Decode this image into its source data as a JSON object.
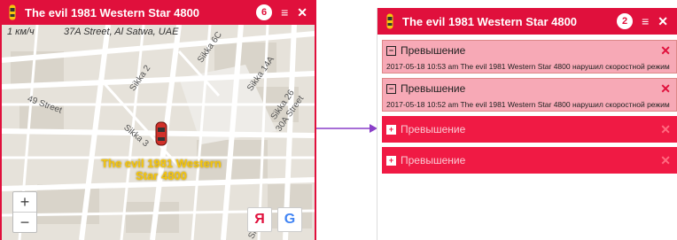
{
  "map_window": {
    "title": "The evil 1981 Western Star 4800",
    "badge": "6",
    "scale": "1 км/ч",
    "address": "37A Street, Al Satwa, UAE",
    "streets": [
      "Sikka 6C",
      "Sikka 2",
      "Sikka 14A",
      "49 Street",
      "Sikka 26",
      "Sikka 3",
      "30A Street",
      "Sikka"
    ],
    "vehicle_label_line1": "The evil 1981 Western",
    "vehicle_label_line2": "Star 4800",
    "zoom_in": "+",
    "zoom_out": "−",
    "yandex_label": "Я",
    "google_label": "G",
    "menu_icon": "menu-icon",
    "close_icon": "close-icon",
    "accent_color": "#e0103c",
    "label_color": "#f4c50e"
  },
  "alerts_window": {
    "title": "The evil 1981 Western Star 4800",
    "badge": "2",
    "alerts": [
      {
        "title": "Превышение",
        "text": "2017-05-18 10:53 am The evil 1981 Western Star 4800 нарушил скоростной режим",
        "state": "expanded"
      },
      {
        "title": "Превышение",
        "text": "2017-05-18 10:52 am The evil 1981 Western Star 4800 нарушил скоростной режим",
        "state": "expanded"
      },
      {
        "title": "Превышение",
        "state": "collapsed"
      },
      {
        "title": "Превышение",
        "state": "collapsed"
      }
    ],
    "expanded_color": "#f7a9b6",
    "collapsed_color": "#f01a44"
  }
}
